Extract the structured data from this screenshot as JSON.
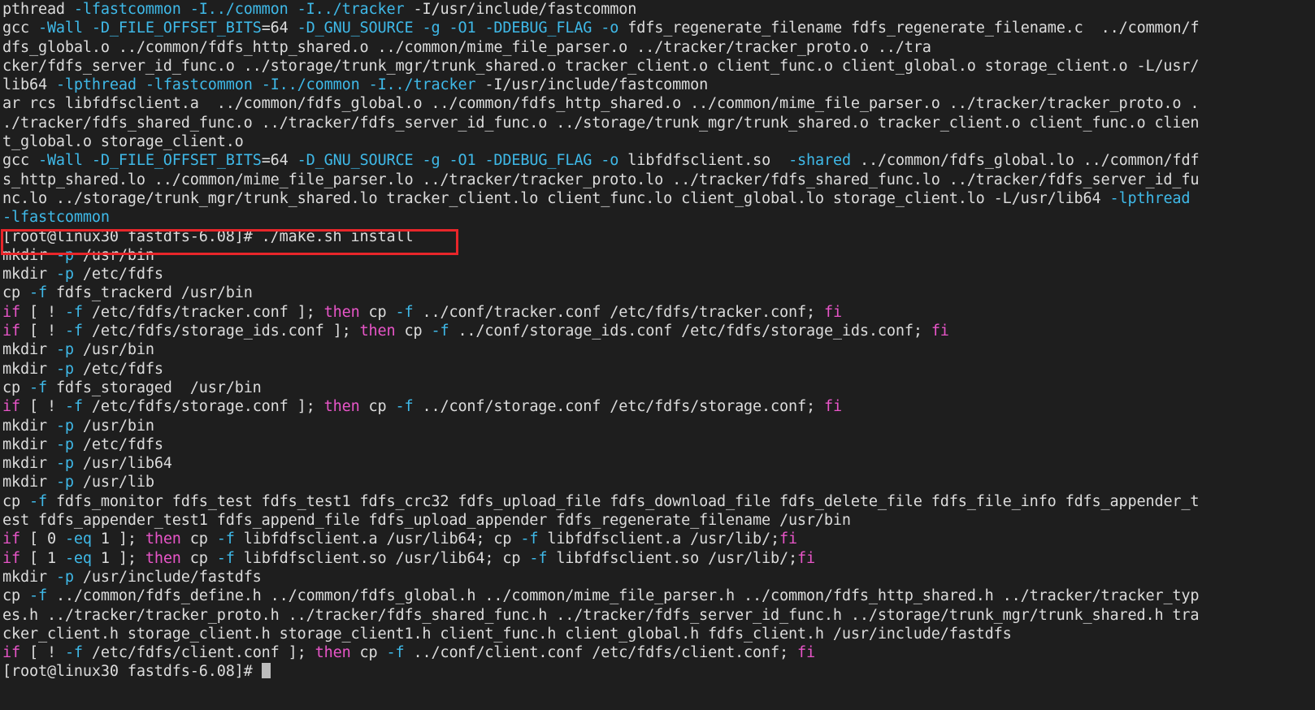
{
  "terminal": {
    "background_color": "#1e1e1e",
    "foreground_color": "#dcdcdc",
    "flag_color": "#3fb9e8",
    "keyword_color": "#e855c8",
    "highlight_box_color": "#e8262a",
    "cursor_color": "#bdbdbd",
    "hostname": "linux30",
    "user": "root",
    "working_directory": "fastdfs-6.08",
    "prompt": "[root@linux30 fastdfs-6.08]#",
    "highlighted_command": "./make.sh install",
    "lines": [
      [
        {
          "t": "pthread ",
          "c": "default"
        },
        {
          "t": "-lfastcommon",
          "c": "flag"
        },
        {
          "t": " ",
          "c": "default"
        },
        {
          "t": "-I../common",
          "c": "flag"
        },
        {
          "t": " ",
          "c": "default"
        },
        {
          "t": "-I../tracker",
          "c": "flag"
        },
        {
          "t": " -I/usr/include/fastcommon",
          "c": "default"
        }
      ],
      [
        {
          "t": "gcc ",
          "c": "default"
        },
        {
          "t": "-Wall",
          "c": "flag"
        },
        {
          "t": " ",
          "c": "default"
        },
        {
          "t": "-D_FILE_OFFSET_BITS",
          "c": "flag"
        },
        {
          "t": "=64 ",
          "c": "default"
        },
        {
          "t": "-D_GNU_SOURCE",
          "c": "flag"
        },
        {
          "t": " ",
          "c": "default"
        },
        {
          "t": "-g",
          "c": "flag"
        },
        {
          "t": " ",
          "c": "default"
        },
        {
          "t": "-O1",
          "c": "flag"
        },
        {
          "t": " ",
          "c": "default"
        },
        {
          "t": "-DDEBUG_FLAG",
          "c": "flag"
        },
        {
          "t": " ",
          "c": "default"
        },
        {
          "t": "-o",
          "c": "flag"
        },
        {
          "t": " fdfs_regenerate_filename fdfs_regenerate_filename.c  ../common/f",
          "c": "default"
        }
      ],
      [
        {
          "t": "dfs_global.o ../common/fdfs_http_shared.o ../common/mime_file_parser.o ../tracker/tracker_proto.o ../tra",
          "c": "default"
        }
      ],
      [
        {
          "t": "cker/fdfs_server_id_func.o ../storage/trunk_mgr/trunk_shared.o tracker_client.o client_func.o client_global.o storage_client.o -L/usr/",
          "c": "default"
        }
      ],
      [
        {
          "t": "lib64 ",
          "c": "default"
        },
        {
          "t": "-lpthread",
          "c": "flag"
        },
        {
          "t": " ",
          "c": "default"
        },
        {
          "t": "-lfastcommon",
          "c": "flag"
        },
        {
          "t": " ",
          "c": "default"
        },
        {
          "t": "-I../common",
          "c": "flag"
        },
        {
          "t": " ",
          "c": "default"
        },
        {
          "t": "-I../tracker",
          "c": "flag"
        },
        {
          "t": " -I/usr/include/fastcommon",
          "c": "default"
        }
      ],
      [
        {
          "t": "ar rcs libfdfsclient.a  ../common/fdfs_global.o ../common/fdfs_http_shared.o ../common/mime_file_parser.o ../tracker/tracker_proto.o .",
          "c": "default"
        }
      ],
      [
        {
          "t": "./tracker/fdfs_shared_func.o ../tracker/fdfs_server_id_func.o ../storage/trunk_mgr/trunk_shared.o tracker_client.o client_func.o clien",
          "c": "default"
        }
      ],
      [
        {
          "t": "t_global.o storage_client.o",
          "c": "default"
        }
      ],
      [
        {
          "t": "gcc ",
          "c": "default"
        },
        {
          "t": "-Wall",
          "c": "flag"
        },
        {
          "t": " ",
          "c": "default"
        },
        {
          "t": "-D_FILE_OFFSET_BITS",
          "c": "flag"
        },
        {
          "t": "=64 ",
          "c": "default"
        },
        {
          "t": "-D_GNU_SOURCE",
          "c": "flag"
        },
        {
          "t": " ",
          "c": "default"
        },
        {
          "t": "-g",
          "c": "flag"
        },
        {
          "t": " ",
          "c": "default"
        },
        {
          "t": "-O1",
          "c": "flag"
        },
        {
          "t": " ",
          "c": "default"
        },
        {
          "t": "-DDEBUG_FLAG",
          "c": "flag"
        },
        {
          "t": " ",
          "c": "default"
        },
        {
          "t": "-o",
          "c": "flag"
        },
        {
          "t": " libfdfsclient.so  ",
          "c": "default"
        },
        {
          "t": "-shared",
          "c": "flag"
        },
        {
          "t": " ../common/fdfs_global.lo ../common/fdf",
          "c": "default"
        }
      ],
      [
        {
          "t": "s_http_shared.lo ../common/mime_file_parser.lo ../tracker/tracker_proto.lo ../tracker/fdfs_shared_func.lo ../tracker/fdfs_server_id_fu",
          "c": "default"
        }
      ],
      [
        {
          "t": "nc.lo ../storage/trunk_mgr/trunk_shared.lo tracker_client.lo client_func.lo client_global.lo storage_client.lo -L/usr/lib64 ",
          "c": "default"
        },
        {
          "t": "-lpthread",
          "c": "flag"
        }
      ],
      [
        {
          "t": "-lfastcommon",
          "c": "flag"
        }
      ],
      [
        {
          "t": "[root@linux30 fastdfs-6.08]# ./make.sh install",
          "c": "prompt"
        }
      ],
      [
        {
          "t": "mkdir ",
          "c": "default"
        },
        {
          "t": "-p",
          "c": "flag"
        },
        {
          "t": " /usr/bin",
          "c": "default"
        }
      ],
      [
        {
          "t": "mkdir ",
          "c": "default"
        },
        {
          "t": "-p",
          "c": "flag"
        },
        {
          "t": " /etc/fdfs",
          "c": "default"
        }
      ],
      [
        {
          "t": "cp ",
          "c": "default"
        },
        {
          "t": "-f",
          "c": "flag"
        },
        {
          "t": " fdfs_trackerd /usr/bin",
          "c": "default"
        }
      ],
      [
        {
          "t": "if",
          "c": "kw"
        },
        {
          "t": " [ ! ",
          "c": "default"
        },
        {
          "t": "-f",
          "c": "flag"
        },
        {
          "t": " /etc/fdfs/tracker.conf ]; ",
          "c": "default"
        },
        {
          "t": "then",
          "c": "kw"
        },
        {
          "t": " cp ",
          "c": "default"
        },
        {
          "t": "-f",
          "c": "flag"
        },
        {
          "t": " ../conf/tracker.conf /etc/fdfs/tracker.conf; ",
          "c": "default"
        },
        {
          "t": "fi",
          "c": "kw"
        }
      ],
      [
        {
          "t": "if",
          "c": "kw"
        },
        {
          "t": " [ ! ",
          "c": "default"
        },
        {
          "t": "-f",
          "c": "flag"
        },
        {
          "t": " /etc/fdfs/storage_ids.conf ]; ",
          "c": "default"
        },
        {
          "t": "then",
          "c": "kw"
        },
        {
          "t": " cp ",
          "c": "default"
        },
        {
          "t": "-f",
          "c": "flag"
        },
        {
          "t": " ../conf/storage_ids.conf /etc/fdfs/storage_ids.conf; ",
          "c": "default"
        },
        {
          "t": "fi",
          "c": "kw"
        }
      ],
      [
        {
          "t": "mkdir ",
          "c": "default"
        },
        {
          "t": "-p",
          "c": "flag"
        },
        {
          "t": " /usr/bin",
          "c": "default"
        }
      ],
      [
        {
          "t": "mkdir ",
          "c": "default"
        },
        {
          "t": "-p",
          "c": "flag"
        },
        {
          "t": " /etc/fdfs",
          "c": "default"
        }
      ],
      [
        {
          "t": "cp ",
          "c": "default"
        },
        {
          "t": "-f",
          "c": "flag"
        },
        {
          "t": " fdfs_storaged  /usr/bin",
          "c": "default"
        }
      ],
      [
        {
          "t": "if",
          "c": "kw"
        },
        {
          "t": " [ ! ",
          "c": "default"
        },
        {
          "t": "-f",
          "c": "flag"
        },
        {
          "t": " /etc/fdfs/storage.conf ]; ",
          "c": "default"
        },
        {
          "t": "then",
          "c": "kw"
        },
        {
          "t": " cp ",
          "c": "default"
        },
        {
          "t": "-f",
          "c": "flag"
        },
        {
          "t": " ../conf/storage.conf /etc/fdfs/storage.conf; ",
          "c": "default"
        },
        {
          "t": "fi",
          "c": "kw"
        }
      ],
      [
        {
          "t": "mkdir ",
          "c": "default"
        },
        {
          "t": "-p",
          "c": "flag"
        },
        {
          "t": " /usr/bin",
          "c": "default"
        }
      ],
      [
        {
          "t": "mkdir ",
          "c": "default"
        },
        {
          "t": "-p",
          "c": "flag"
        },
        {
          "t": " /etc/fdfs",
          "c": "default"
        }
      ],
      [
        {
          "t": "mkdir ",
          "c": "default"
        },
        {
          "t": "-p",
          "c": "flag"
        },
        {
          "t": " /usr/lib64",
          "c": "default"
        }
      ],
      [
        {
          "t": "mkdir ",
          "c": "default"
        },
        {
          "t": "-p",
          "c": "flag"
        },
        {
          "t": " /usr/lib",
          "c": "default"
        }
      ],
      [
        {
          "t": "cp ",
          "c": "default"
        },
        {
          "t": "-f",
          "c": "flag"
        },
        {
          "t": " fdfs_monitor fdfs_test fdfs_test1 fdfs_crc32 fdfs_upload_file fdfs_download_file fdfs_delete_file fdfs_file_info fdfs_appender_t",
          "c": "default"
        }
      ],
      [
        {
          "t": "est fdfs_appender_test1 fdfs_append_file fdfs_upload_appender fdfs_regenerate_filename /usr/bin",
          "c": "default"
        }
      ],
      [
        {
          "t": "if",
          "c": "kw"
        },
        {
          "t": " [ 0 ",
          "c": "default"
        },
        {
          "t": "-eq",
          "c": "flag"
        },
        {
          "t": " 1 ]; ",
          "c": "default"
        },
        {
          "t": "then",
          "c": "kw"
        },
        {
          "t": " cp ",
          "c": "default"
        },
        {
          "t": "-f",
          "c": "flag"
        },
        {
          "t": " libfdfsclient.a /usr/lib64; cp ",
          "c": "default"
        },
        {
          "t": "-f",
          "c": "flag"
        },
        {
          "t": " libfdfsclient.a /usr/lib/;",
          "c": "default"
        },
        {
          "t": "fi",
          "c": "kw"
        }
      ],
      [
        {
          "t": "if",
          "c": "kw"
        },
        {
          "t": " [ 1 ",
          "c": "default"
        },
        {
          "t": "-eq",
          "c": "flag"
        },
        {
          "t": " 1 ]; ",
          "c": "default"
        },
        {
          "t": "then",
          "c": "kw"
        },
        {
          "t": " cp ",
          "c": "default"
        },
        {
          "t": "-f",
          "c": "flag"
        },
        {
          "t": " libfdfsclient.so /usr/lib64; cp ",
          "c": "default"
        },
        {
          "t": "-f",
          "c": "flag"
        },
        {
          "t": " libfdfsclient.so /usr/lib/;",
          "c": "default"
        },
        {
          "t": "fi",
          "c": "kw"
        }
      ],
      [
        {
          "t": "mkdir ",
          "c": "default"
        },
        {
          "t": "-p",
          "c": "flag"
        },
        {
          "t": " /usr/include/fastdfs",
          "c": "default"
        }
      ],
      [
        {
          "t": "cp ",
          "c": "default"
        },
        {
          "t": "-f",
          "c": "flag"
        },
        {
          "t": " ../common/fdfs_define.h ../common/fdfs_global.h ../common/mime_file_parser.h ../common/fdfs_http_shared.h ../tracker/tracker_typ",
          "c": "default"
        }
      ],
      [
        {
          "t": "es.h ../tracker/tracker_proto.h ../tracker/fdfs_shared_func.h ../tracker/fdfs_server_id_func.h ../storage/trunk_mgr/trunk_shared.h tra",
          "c": "default"
        }
      ],
      [
        {
          "t": "cker_client.h storage_client.h storage_client1.h client_func.h client_global.h fdfs_client.h /usr/include/fastdfs",
          "c": "default"
        }
      ],
      [
        {
          "t": "if",
          "c": "kw"
        },
        {
          "t": " [ ! ",
          "c": "default"
        },
        {
          "t": "-f",
          "c": "flag"
        },
        {
          "t": " /etc/fdfs/client.conf ]; ",
          "c": "default"
        },
        {
          "t": "then",
          "c": "kw"
        },
        {
          "t": " cp ",
          "c": "default"
        },
        {
          "t": "-f",
          "c": "flag"
        },
        {
          "t": " ../conf/client.conf /etc/fdfs/client.conf; ",
          "c": "default"
        },
        {
          "t": "fi",
          "c": "kw"
        }
      ],
      [
        {
          "t": "[root@linux30 fastdfs-6.08]# ",
          "c": "prompt"
        },
        {
          "t": "",
          "c": "cursor"
        }
      ]
    ]
  }
}
